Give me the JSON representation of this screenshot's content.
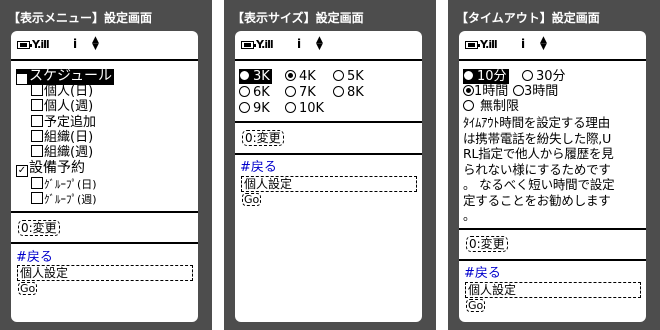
{
  "status_bar": {
    "antenna": "Y.ill",
    "info_glyph": "i",
    "scroll_glyph": "▲▼"
  },
  "panel1": {
    "title": "【表示メニュー】設定画面",
    "items": [
      {
        "label": "スケジュール",
        "checked": true,
        "mark": "✓"
      },
      {
        "label": "個人(日)",
        "checked": false,
        "mark": ""
      },
      {
        "label": "個人(週)",
        "checked": false,
        "mark": ""
      },
      {
        "label": "予定追加",
        "checked": false,
        "mark": ""
      },
      {
        "label": "組織(日)",
        "checked": false,
        "mark": ""
      },
      {
        "label": "組織(週)",
        "checked": false,
        "mark": ""
      },
      {
        "label": "設備予約",
        "checked": true,
        "mark": "✓"
      },
      {
        "label": "ｸﾞﾙｰﾌﾟ(日)",
        "checked": false,
        "mark": ""
      },
      {
        "label": "ｸﾞﾙｰﾌﾟ(週)",
        "checked": false,
        "mark": ""
      }
    ],
    "change_button": "0:変更",
    "back_link": "#戻る",
    "field_value": "個人設定",
    "go_button": "Go"
  },
  "panel2": {
    "title": "【表示サイズ】設定画面",
    "options": [
      "3K",
      "4K",
      "5K",
      "6K",
      "7K",
      "8K",
      "9K",
      "10K"
    ],
    "selected": "4K",
    "highlighted": "3K",
    "change_button": "0:変更",
    "back_link": "#戻る",
    "field_value": "個人設定",
    "go_button": "Go"
  },
  "panel3": {
    "title": "【タイムアウト】設定画面",
    "options": [
      "10分",
      "30分",
      "1時間",
      "3時間",
      "無制限"
    ],
    "selected": "1時間",
    "highlighted": "10分",
    "description_lines": [
      "ﾀｲﾑｱｳﾄ時間を設定する理由",
      "は携帯電話を紛失した際,U",
      "RL指定で他人から履歴を見",
      "られない様にするためです",
      "。 なるべく短い時間で設定",
      "定することをお勧めします",
      "。"
    ],
    "change_button": "0:変更",
    "back_link": "#戻る",
    "field_value": "個人設定",
    "go_button": "Go"
  }
}
